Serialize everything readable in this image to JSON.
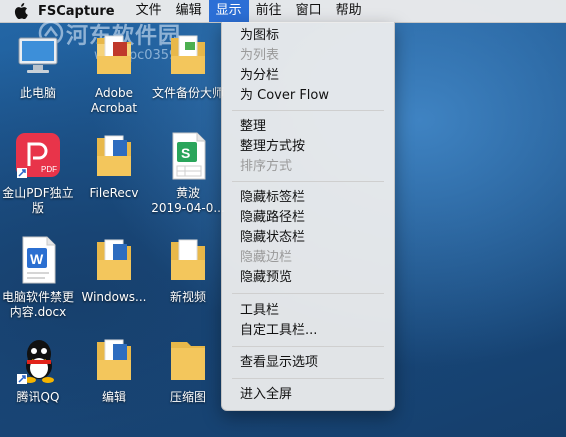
{
  "menubar": {
    "app_name": "FSCapture",
    "menus": [
      "文件",
      "编辑",
      "显示",
      "前往",
      "窗口",
      "帮助"
    ]
  },
  "watermark": {
    "title": "河东软件园",
    "url": "www.pc0359.cn"
  },
  "desktop_icons": [
    {
      "label1": "此电脑",
      "label2": "",
      "icon": "computer-icon"
    },
    {
      "label1": "Adobe",
      "label2": "Acrobat",
      "icon": "folder-icon"
    },
    {
      "label1": "文件备份大师",
      "label2": "",
      "icon": "folder-icon"
    },
    {
      "label1": "金山PDF独立",
      "label2": "版",
      "icon": "pdf-app-icon"
    },
    {
      "label1": "FileRecv",
      "label2": "",
      "icon": "folder-icon"
    },
    {
      "label1": "黄波",
      "label2": "2019-04-0...",
      "icon": "spreadsheet-icon"
    },
    {
      "label1": "电脑软件禁更",
      "label2": "内容.docx",
      "icon": "word-doc-icon"
    },
    {
      "label1": "Windows...",
      "label2": "",
      "icon": "folder-icon"
    },
    {
      "label1": "新视频",
      "label2": "",
      "icon": "folder-icon"
    },
    {
      "label1": "腾讯QQ",
      "label2": "",
      "icon": "qq-icon"
    },
    {
      "label1": "编辑",
      "label2": "",
      "icon": "folder-icon"
    },
    {
      "label1": "压缩图",
      "label2": "",
      "icon": "folder-icon"
    }
  ],
  "dropdown": {
    "items": [
      {
        "label": "为图标",
        "disabled": false
      },
      {
        "label": "为列表",
        "disabled": true
      },
      {
        "label": "为分栏",
        "disabled": false
      },
      {
        "label": "为 Cover Flow",
        "disabled": false
      },
      {
        "label": "整理",
        "disabled": false
      },
      {
        "label": "整理方式按",
        "disabled": false
      },
      {
        "label": "排序方式",
        "disabled": true
      },
      {
        "label": "隐藏标签栏",
        "disabled": false
      },
      {
        "label": "隐藏路径栏",
        "disabled": false
      },
      {
        "label": "隐藏状态栏",
        "disabled": false
      },
      {
        "label": "隐藏边栏",
        "disabled": true
      },
      {
        "label": "隐藏预览",
        "disabled": false
      },
      {
        "label": "工具栏",
        "disabled": false
      },
      {
        "label": "自定工具栏...",
        "disabled": false
      },
      {
        "label": "查看显示选项",
        "disabled": false
      },
      {
        "label": "进入全屏",
        "disabled": false
      }
    ]
  }
}
